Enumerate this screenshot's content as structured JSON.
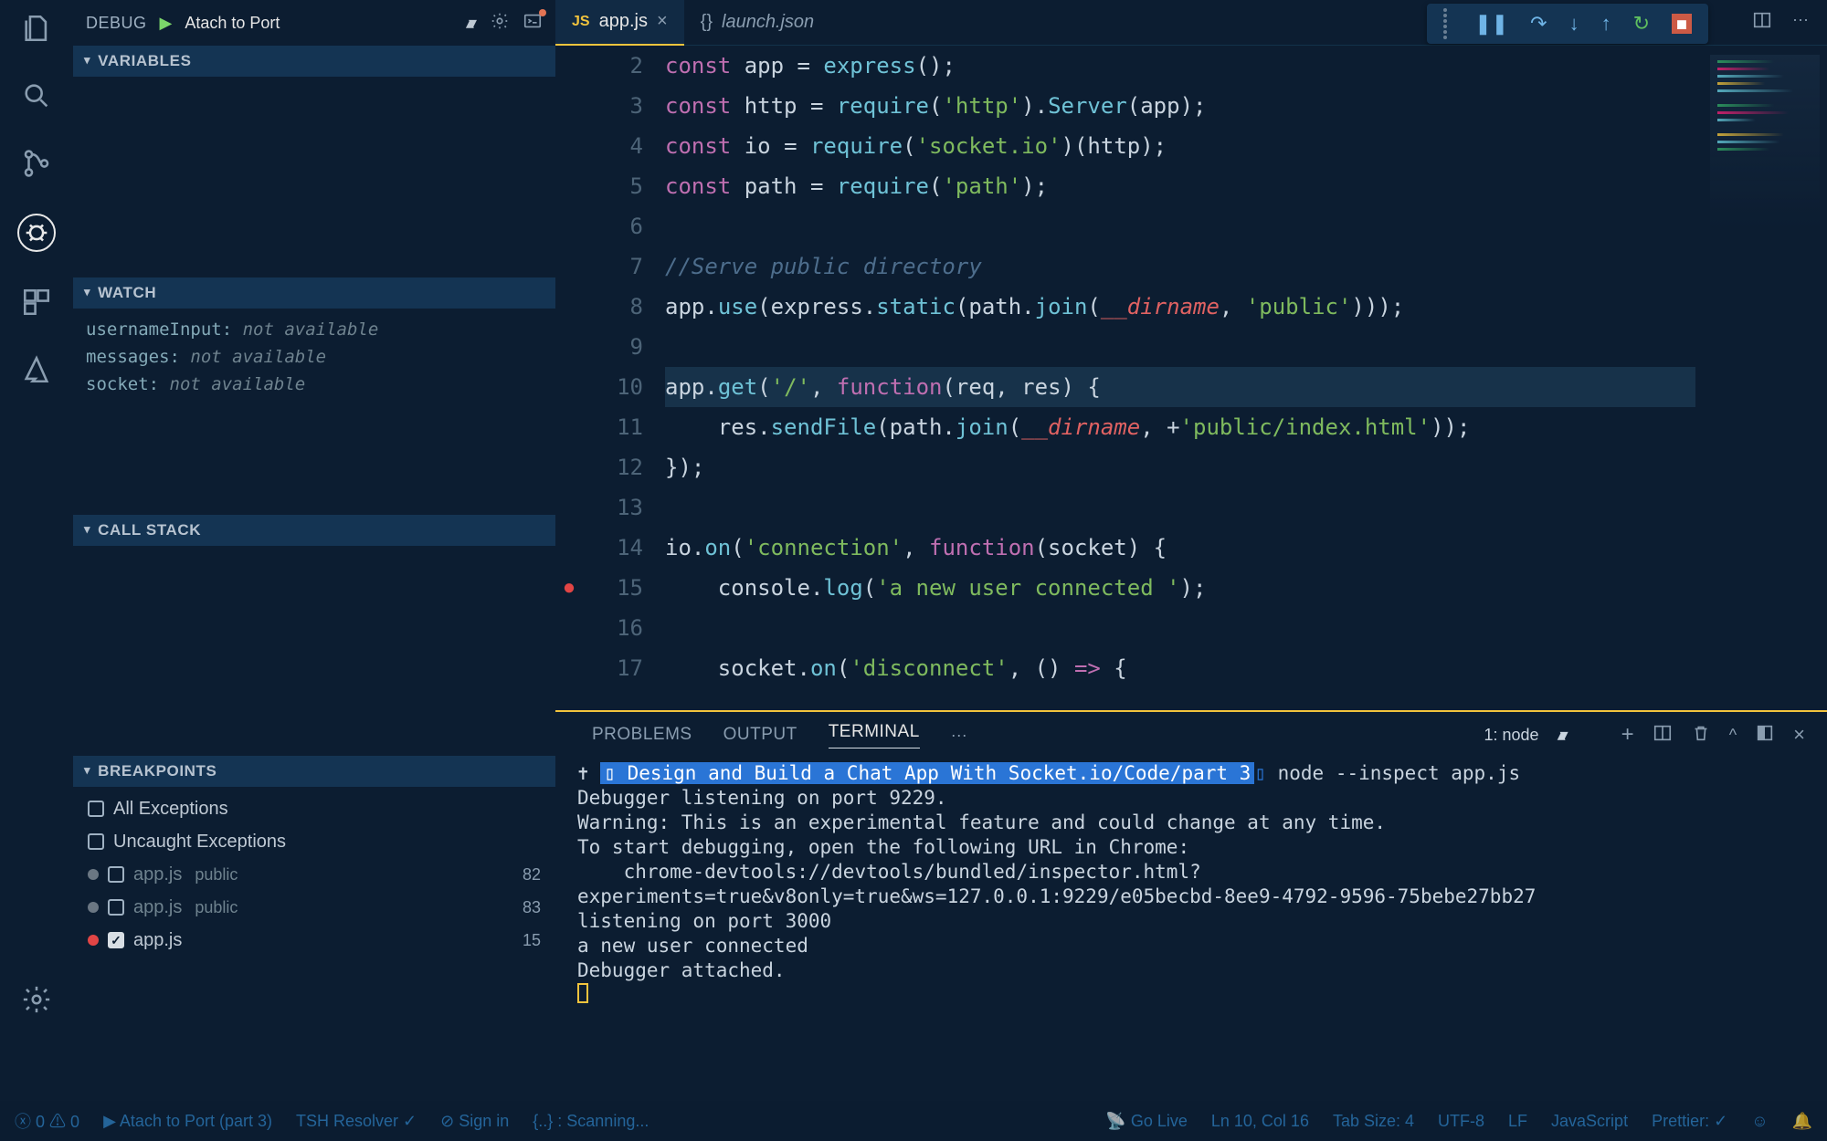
{
  "debug": {
    "label": "DEBUG",
    "config": "Atach to Port"
  },
  "sections": {
    "variables": "VARIABLES",
    "watch": "WATCH",
    "callstack": "CALL STACK",
    "breakpoints": "BREAKPOINTS"
  },
  "watch": [
    {
      "name": "usernameInput:",
      "val": " not available"
    },
    {
      "name": "messages:",
      "val": " not available"
    },
    {
      "name": "socket:",
      "val": " not available"
    }
  ],
  "breakpoints": {
    "all": "All Exceptions",
    "uncaught": "Uncaught Exceptions",
    "items": [
      {
        "file": "app.js",
        "path": "public",
        "line": "82",
        "active": false
      },
      {
        "file": "app.js",
        "path": "public",
        "line": "83",
        "active": false
      },
      {
        "file": "app.js",
        "path": "",
        "line": "15",
        "active": true
      }
    ]
  },
  "tabs": {
    "active": {
      "lang": "JS",
      "name": "app.js"
    },
    "inactive": {
      "lang": "{}",
      "name": "launch.json"
    }
  },
  "editor": {
    "first_line": 2,
    "bp_line": 15,
    "lines": [
      [
        {
          "c": "kw",
          "t": "const "
        },
        {
          "c": "id",
          "t": "app "
        },
        {
          "c": "op",
          "t": "= "
        },
        {
          "c": "fn",
          "t": "express"
        },
        {
          "c": "op",
          "t": "();"
        }
      ],
      [
        {
          "c": "kw",
          "t": "const "
        },
        {
          "c": "id",
          "t": "http "
        },
        {
          "c": "op",
          "t": "= "
        },
        {
          "c": "fn",
          "t": "require"
        },
        {
          "c": "op",
          "t": "("
        },
        {
          "c": "str",
          "t": "'http'"
        },
        {
          "c": "op",
          "t": ")."
        },
        {
          "c": "fn",
          "t": "Server"
        },
        {
          "c": "op",
          "t": "(app);"
        }
      ],
      [
        {
          "c": "kw",
          "t": "const "
        },
        {
          "c": "id",
          "t": "io "
        },
        {
          "c": "op",
          "t": "= "
        },
        {
          "c": "fn",
          "t": "require"
        },
        {
          "c": "op",
          "t": "("
        },
        {
          "c": "str",
          "t": "'socket.io'"
        },
        {
          "c": "op",
          "t": ")(http);"
        }
      ],
      [
        {
          "c": "kw",
          "t": "const "
        },
        {
          "c": "id",
          "t": "path "
        },
        {
          "c": "op",
          "t": "= "
        },
        {
          "c": "fn",
          "t": "require"
        },
        {
          "c": "op",
          "t": "("
        },
        {
          "c": "str",
          "t": "'path'"
        },
        {
          "c": "op",
          "t": ");"
        }
      ],
      [],
      [
        {
          "c": "cm",
          "t": "//Serve public directory"
        }
      ],
      [
        {
          "c": "id",
          "t": "app"
        },
        {
          "c": "op",
          "t": "."
        },
        {
          "c": "fn",
          "t": "use"
        },
        {
          "c": "op",
          "t": "(express."
        },
        {
          "c": "fn",
          "t": "static"
        },
        {
          "c": "op",
          "t": "(path."
        },
        {
          "c": "fn",
          "t": "join"
        },
        {
          "c": "op",
          "t": "("
        },
        {
          "c": "var",
          "t": "__dirname"
        },
        {
          "c": "op",
          "t": ", "
        },
        {
          "c": "str",
          "t": "'public'"
        },
        {
          "c": "op",
          "t": ")));"
        }
      ],
      [],
      [
        {
          "c": "id",
          "t": "app"
        },
        {
          "c": "op",
          "t": "."
        },
        {
          "c": "fn",
          "t": "get"
        },
        {
          "c": "op",
          "t": "("
        },
        {
          "c": "str",
          "t": "'/'"
        },
        {
          "c": "op",
          "t": ", "
        },
        {
          "c": "kw",
          "t": "function"
        },
        {
          "c": "op",
          "t": "(req, res) {"
        }
      ],
      [
        {
          "c": "op",
          "t": "    res."
        },
        {
          "c": "fn",
          "t": "sendFile"
        },
        {
          "c": "op",
          "t": "(path."
        },
        {
          "c": "fn",
          "t": "join"
        },
        {
          "c": "op",
          "t": "("
        },
        {
          "c": "var",
          "t": "__dirname"
        },
        {
          "c": "op",
          "t": ", +"
        },
        {
          "c": "str",
          "t": "'public/index.html'"
        },
        {
          "c": "op",
          "t": "));"
        }
      ],
      [
        {
          "c": "op",
          "t": "});"
        }
      ],
      [],
      [
        {
          "c": "id",
          "t": "io"
        },
        {
          "c": "op",
          "t": "."
        },
        {
          "c": "fn",
          "t": "on"
        },
        {
          "c": "op",
          "t": "("
        },
        {
          "c": "str",
          "t": "'connection'"
        },
        {
          "c": "op",
          "t": ", "
        },
        {
          "c": "kw",
          "t": "function"
        },
        {
          "c": "op",
          "t": "(socket) {"
        }
      ],
      [
        {
          "c": "op",
          "t": "    console."
        },
        {
          "c": "fn",
          "t": "log"
        },
        {
          "c": "op",
          "t": "("
        },
        {
          "c": "str",
          "t": "'a new user connected '"
        },
        {
          "c": "op",
          "t": ");"
        }
      ],
      [],
      [
        {
          "c": "op",
          "t": "    socket."
        },
        {
          "c": "fn",
          "t": "on"
        },
        {
          "c": "op",
          "t": "("
        },
        {
          "c": "str",
          "t": "'disconnect'"
        },
        {
          "c": "op",
          "t": ", () "
        },
        {
          "c": "kw",
          "t": "=>"
        },
        {
          "c": "op",
          "t": " {"
        }
      ]
    ],
    "highlight_line": 10
  },
  "panel": {
    "tabs": {
      "problems": "PROBLEMS",
      "output": "OUTPUT",
      "terminal": "TERMINAL"
    },
    "term_select": "1: node",
    "path": "Design and Build a Chat App With Socket.io/Code/part 3",
    "cmd": " node --inspect app.js",
    "lines": [
      "Debugger listening on port 9229.",
      "Warning: This is an experimental feature and could change at any time.",
      "To start debugging, open the following URL in Chrome:",
      "    chrome-devtools://devtools/bundled/inspector.html?experiments=true&v8only=true&ws=127.0.0.1:9229/e05becbd-8ee9-4792-9596-75bebe27bb27",
      "listening on port 3000",
      "a new user connected",
      "Debugger attached."
    ]
  },
  "status": {
    "err": "0",
    "warn": "0",
    "launch": "Atach to Port (part 3)",
    "resolver": "TSH Resolver ✓",
    "signin": "Sign in",
    "scan": "{..} : Scanning...",
    "golive": "Go Live",
    "pos": "Ln 10, Col 16",
    "tab": "Tab Size: 4",
    "enc": "UTF-8",
    "eol": "LF",
    "lang": "JavaScript",
    "prettier": "Prettier: ✓"
  }
}
